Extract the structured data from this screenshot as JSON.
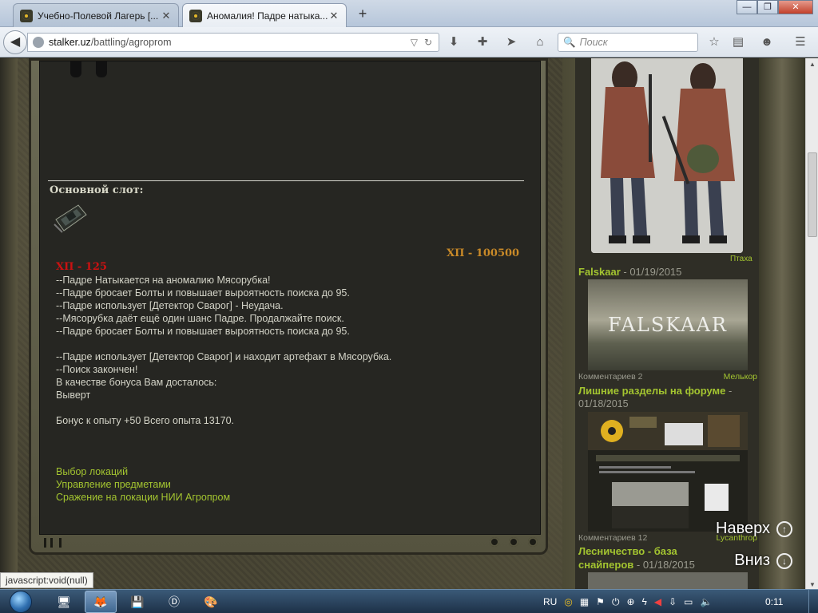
{
  "browser": {
    "tabs": [
      {
        "label": "Учебно-Полевой Лагерь [...",
        "close": "✕"
      },
      {
        "label": "Аномалия! Падре натыка...",
        "close": "✕"
      }
    ],
    "new_tab": "+",
    "window_buttons": {
      "minimize": "—",
      "maximize": "❐",
      "close": "✕"
    },
    "back": "◀",
    "url_host": "stalker.uz",
    "url_path": "/battling/agroprom",
    "url_dropdown": "▽",
    "url_reload": "↻",
    "search_placeholder": "Поиск",
    "search_icon": "🔍",
    "nav_icons": [
      "download-icon",
      "addon-icon",
      "send-icon",
      "home-icon",
      "bookmark-star-icon",
      "reading-list-icon",
      "chat-icon",
      "menu-icon"
    ],
    "nav_glyphs": [
      "⬇",
      "✚",
      "➤",
      "⌂",
      "☆",
      "▤",
      "☻",
      "☰"
    ]
  },
  "page": {
    "slot_label": "Основной слот:",
    "hp_main": "ХП - 100500",
    "hp_damage": "ХП - 125",
    "log_lines": [
      "--Падре Натыкается на аномалию Мясорубка!",
      "--Падре бросает Болты и повышает выроятность поиска до 95.",
      "--Падре использует [Детектор Сварог] - Неудача.",
      "--Мясорубка даёт ещё один шанс Падре. Продалжайте поиск.",
      "--Падре бросает Болты и повышает выроятность поиска до 95.",
      "",
      "--Падре использует [Детектор Сварог] и находит артефакт в Мясорубка.",
      "--Поиск закончен!",
      "В качестве бонуса Вам досталось:",
      "Выверт",
      "",
      "Бонус к опыту +50 Всего опыта 13170."
    ],
    "links": [
      "Выбор локаций",
      "Управление предметами",
      "Сражение на локации НИИ Агропром"
    ]
  },
  "sidebar": {
    "ptaha": "Птаха",
    "news": [
      {
        "title": "Falskaar",
        "sep": " - ",
        "date": "01/19/2015",
        "image_text": "FALSKAAR",
        "comments": "Комментариев 2",
        "author": "Мелькор"
      },
      {
        "title": "Лишние разделы на форуме",
        "sep": " -",
        "date": "01/18/2015",
        "comments": "Комментариев 12",
        "author": "Lycanthrop"
      },
      {
        "title": "Лесничество - база",
        "title2": "снайперов",
        "sep": " - ",
        "date": "01/18/2015"
      }
    ],
    "float_up": "Наверх",
    "float_up_icon": "↑",
    "float_down": "Вниз",
    "float_down_icon": "↓"
  },
  "scrollbar": {
    "up": "▲",
    "down": "▼"
  },
  "status_text": "javascript:void(null)",
  "taskbar": {
    "lang": "RU",
    "time": "0:11",
    "apps": [
      "explorer-icon",
      "firefox-icon",
      "save-icon",
      "d-app-icon",
      "paint-icon"
    ]
  }
}
